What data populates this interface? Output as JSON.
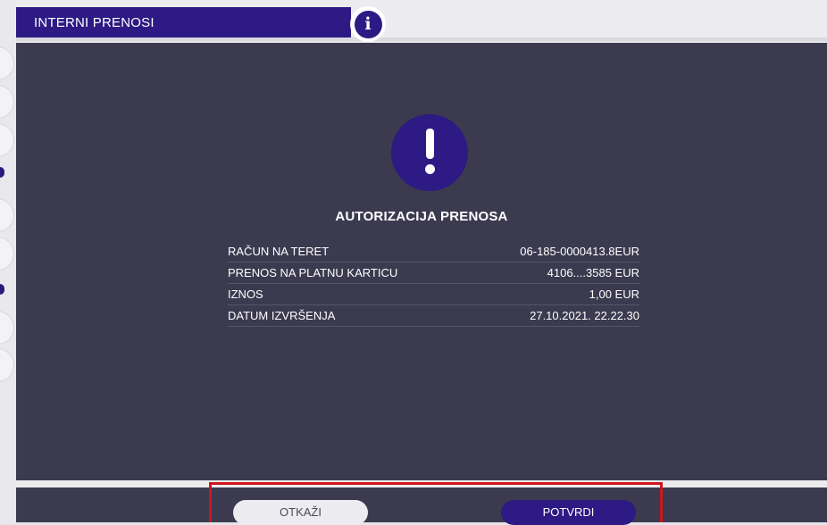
{
  "header": {
    "title": "INTERNI PRENOSI",
    "info_icon": "info-icon",
    "info_glyph": "i"
  },
  "dialog": {
    "icon": "exclamation-icon",
    "title": "AUTORIZACIJA PRENOSA",
    "rows": [
      {
        "label": "RAČUN NA TERET",
        "value": "06-185-0000413.8EUR"
      },
      {
        "label": "PRENOS NA PLATNU KARTICU",
        "value": "4106....3585 EUR"
      },
      {
        "label": "IZNOS",
        "value": "1,00 EUR"
      },
      {
        "label": "DATUM IZVRŠENJA",
        "value": "27.10.2021. 22.22.30"
      }
    ]
  },
  "footer": {
    "cancel_label": "OTKAŽI",
    "confirm_label": "POTVRDI"
  },
  "colors": {
    "brand_purple": "#2d1a84",
    "panel_dark": "#3b3a4f",
    "highlight_red": "#d0151d"
  }
}
